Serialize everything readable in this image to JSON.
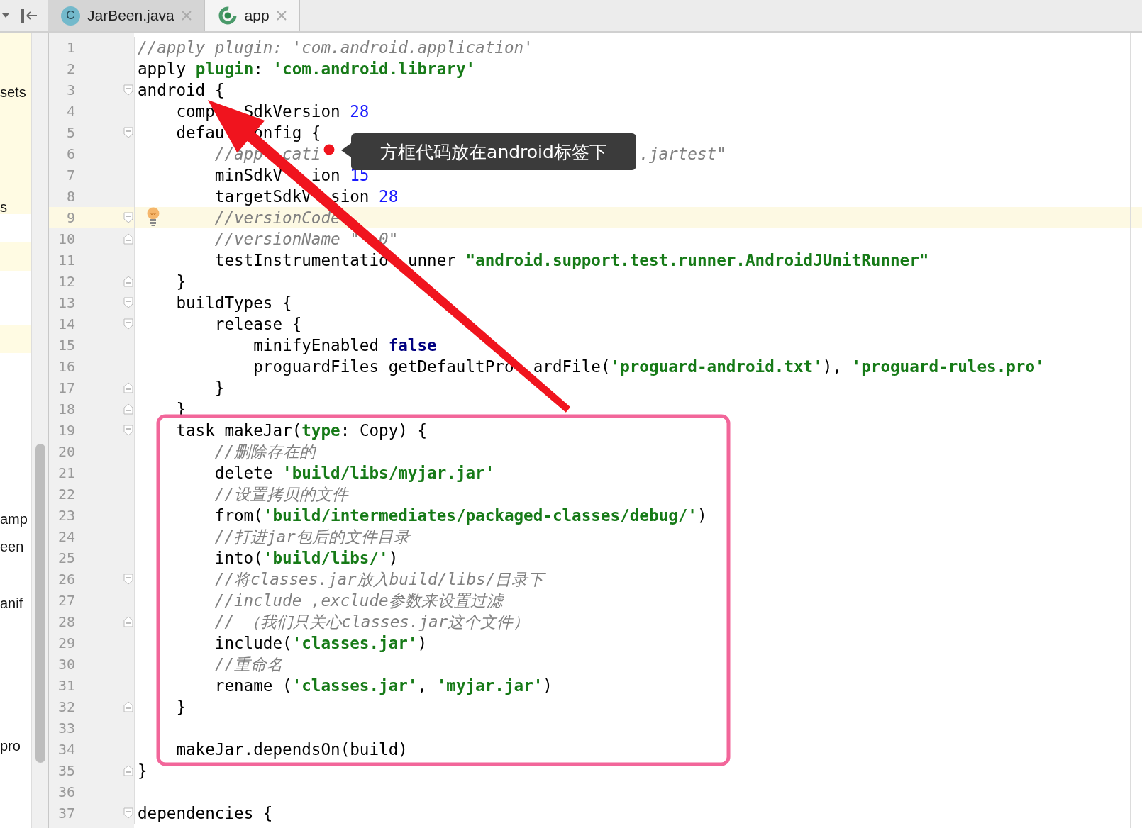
{
  "tabs": [
    {
      "label": "JarBeen.java",
      "kind": "class",
      "icon_letter": "C",
      "selected": false
    },
    {
      "label": "app",
      "kind": "gradle",
      "selected": true
    }
  ],
  "sidebar": {
    "items": [
      "sets",
      "s",
      "amp",
      "een",
      "anif",
      "pro"
    ]
  },
  "lines": [
    {
      "number": "1",
      "current": false,
      "tokens": [
        {
          "kind": "comment",
          "text": "//apply plugin: 'com.android.application'"
        }
      ]
    },
    {
      "number": "2",
      "current": false,
      "tokens": [
        {
          "kind": "plain",
          "text": "apply "
        },
        {
          "kind": "keyword",
          "text": "plugin"
        },
        {
          "kind": "plain",
          "text": ": "
        },
        {
          "kind": "string",
          "text": "'com.android.library'"
        }
      ]
    },
    {
      "number": "3",
      "current": false,
      "fold": {
        "kind": "start"
      },
      "tokens": [
        {
          "kind": "plain",
          "text": "android {"
        }
      ]
    },
    {
      "number": "4",
      "current": false,
      "tokens": [
        {
          "kind": "plain",
          "text": "    comp"
        },
        {
          "kind": "gap"
        },
        {
          "kind": "plain",
          "text": "SdkVersion "
        },
        {
          "kind": "number",
          "text": "28"
        }
      ]
    },
    {
      "number": "5",
      "current": false,
      "fold": {
        "kind": "start"
      },
      "tokens": [
        {
          "kind": "plain",
          "text": "    defau"
        },
        {
          "kind": "gap"
        },
        {
          "kind": "plain",
          "text": "onfig {"
        }
      ]
    },
    {
      "number": "6",
      "current": false,
      "tokens": [
        {
          "kind": "comment",
          "text": "        //app"
        },
        {
          "kind": "gap"
        },
        {
          "kind": "comment",
          "text": "cati"
        },
        {
          "kind": "gap"
        },
        {
          "kind": "comment",
          "text": ".jartest\""
        }
      ]
    },
    {
      "number": "7",
      "current": false,
      "tokens": [
        {
          "kind": "plain",
          "text": "        minSdkV"
        },
        {
          "kind": "gap"
        },
        {
          "kind": "plain",
          "text": "ion "
        },
        {
          "kind": "number",
          "text": "15"
        }
      ]
    },
    {
      "number": "8",
      "current": false,
      "tokens": [
        {
          "kind": "plain",
          "text": "        targetSdkV"
        },
        {
          "kind": "gap"
        },
        {
          "kind": "plain",
          "text": "sion "
        },
        {
          "kind": "number",
          "text": "28"
        }
      ]
    },
    {
      "number": "9",
      "current": true,
      "fold": {
        "kind": "start"
      },
      "gutter_icon": {
        "kind": "bulb"
      },
      "tokens": [
        {
          "kind": "comment",
          "text": "        //versionCode"
        }
      ]
    },
    {
      "number": "10",
      "current": false,
      "fold": {
        "kind": "end"
      },
      "tokens": [
        {
          "kind": "comment",
          "text": "        //versionName \""
        },
        {
          "kind": "gap"
        },
        {
          "kind": "comment",
          "text": "0\""
        }
      ]
    },
    {
      "number": "11",
      "current": false,
      "tokens": [
        {
          "kind": "plain",
          "text": "        testInstrumentatio"
        },
        {
          "kind": "gap"
        },
        {
          "kind": "plain",
          "text": "unner "
        },
        {
          "kind": "string",
          "text": "\"android.support.test.runner.AndroidJUnitRunner\""
        }
      ]
    },
    {
      "number": "12",
      "current": false,
      "fold": {
        "kind": "end"
      },
      "tokens": [
        {
          "kind": "plain",
          "text": "    }"
        }
      ]
    },
    {
      "number": "13",
      "current": false,
      "fold": {
        "kind": "start"
      },
      "tokens": [
        {
          "kind": "plain",
          "text": "    buildTypes {"
        }
      ]
    },
    {
      "number": "14",
      "current": false,
      "fold": {
        "kind": "start"
      },
      "tokens": [
        {
          "kind": "plain",
          "text": "        release {"
        }
      ]
    },
    {
      "number": "15",
      "current": false,
      "tokens": [
        {
          "kind": "plain",
          "text": "            minifyEnabled "
        },
        {
          "kind": "bool",
          "text": "false"
        }
      ]
    },
    {
      "number": "16",
      "current": false,
      "tokens": [
        {
          "kind": "plain",
          "text": "            proguardFiles getDefaultPro"
        },
        {
          "kind": "gap"
        },
        {
          "kind": "plain",
          "text": "ardFile("
        },
        {
          "kind": "string",
          "text": "'proguard-android.txt'"
        },
        {
          "kind": "plain",
          "text": "), "
        },
        {
          "kind": "string",
          "text": "'proguard-rules.pro'"
        }
      ]
    },
    {
      "number": "17",
      "current": false,
      "fold": {
        "kind": "end"
      },
      "tokens": [
        {
          "kind": "plain",
          "text": "        }"
        }
      ]
    },
    {
      "number": "18",
      "current": false,
      "fold": {
        "kind": "end"
      },
      "tokens": [
        {
          "kind": "plain",
          "text": "    }"
        }
      ]
    },
    {
      "number": "19",
      "current": false,
      "fold": {
        "kind": "start"
      },
      "tokens": [
        {
          "kind": "plain",
          "text": "    task makeJar("
        },
        {
          "kind": "keyword",
          "text": "type"
        },
        {
          "kind": "plain",
          "text": ": Copy) {"
        }
      ]
    },
    {
      "number": "20",
      "current": false,
      "tokens": [
        {
          "kind": "comment",
          "text": "        //删除存在的"
        }
      ]
    },
    {
      "number": "21",
      "current": false,
      "tokens": [
        {
          "kind": "plain",
          "text": "        delete "
        },
        {
          "kind": "string",
          "text": "'build/libs/myjar.jar'"
        }
      ]
    },
    {
      "number": "22",
      "current": false,
      "tokens": [
        {
          "kind": "comment",
          "text": "        //设置拷贝的文件"
        }
      ]
    },
    {
      "number": "23",
      "current": false,
      "tokens": [
        {
          "kind": "plain",
          "text": "        from("
        },
        {
          "kind": "string",
          "text": "'build/intermediates/packaged-classes/debug/'"
        },
        {
          "kind": "plain",
          "text": ")"
        }
      ]
    },
    {
      "number": "24",
      "current": false,
      "tokens": [
        {
          "kind": "comment",
          "text": "        //打进jar包后的文件目录"
        }
      ]
    },
    {
      "number": "25",
      "current": false,
      "tokens": [
        {
          "kind": "plain",
          "text": "        into("
        },
        {
          "kind": "string",
          "text": "'build/libs/'"
        },
        {
          "kind": "plain",
          "text": ")"
        }
      ]
    },
    {
      "number": "26",
      "current": false,
      "fold": {
        "kind": "start"
      },
      "tokens": [
        {
          "kind": "comment",
          "text": "        //将classes.jar放入build/libs/目录下"
        }
      ]
    },
    {
      "number": "27",
      "current": false,
      "tokens": [
        {
          "kind": "comment",
          "text": "        //include ,exclude参数来设置过滤"
        }
      ]
    },
    {
      "number": "28",
      "current": false,
      "fold": {
        "kind": "end"
      },
      "tokens": [
        {
          "kind": "comment",
          "text": "        // （我们只关心classes.jar这个文件）"
        }
      ]
    },
    {
      "number": "29",
      "current": false,
      "tokens": [
        {
          "kind": "plain",
          "text": "        include("
        },
        {
          "kind": "string",
          "text": "'classes.jar'"
        },
        {
          "kind": "plain",
          "text": ")"
        }
      ]
    },
    {
      "number": "30",
      "current": false,
      "tokens": [
        {
          "kind": "comment",
          "text": "        //重命名"
        }
      ]
    },
    {
      "number": "31",
      "current": false,
      "tokens": [
        {
          "kind": "plain",
          "text": "        rename ("
        },
        {
          "kind": "string",
          "text": "'classes.jar'"
        },
        {
          "kind": "plain",
          "text": ", "
        },
        {
          "kind": "string",
          "text": "'myjar.jar'"
        },
        {
          "kind": "plain",
          "text": ")"
        }
      ]
    },
    {
      "number": "32",
      "current": false,
      "fold": {
        "kind": "end"
      },
      "tokens": [
        {
          "kind": "plain",
          "text": "    }"
        }
      ]
    },
    {
      "number": "33",
      "current": false
    },
    {
      "number": "34",
      "current": false,
      "tokens": [
        {
          "kind": "plain",
          "text": "    makeJar.dependsOn(build)"
        }
      ]
    },
    {
      "number": "35",
      "current": false,
      "fold": {
        "kind": "end"
      },
      "tokens": [
        {
          "kind": "plain",
          "text": "}"
        }
      ]
    },
    {
      "number": "36",
      "current": false
    },
    {
      "number": "37",
      "current": false,
      "fold": {
        "kind": "start"
      },
      "tokens": [
        {
          "kind": "plain",
          "text": "dependencies {"
        }
      ]
    }
  ],
  "annotation": {
    "tooltip": "方框代码放在android标签下"
  }
}
